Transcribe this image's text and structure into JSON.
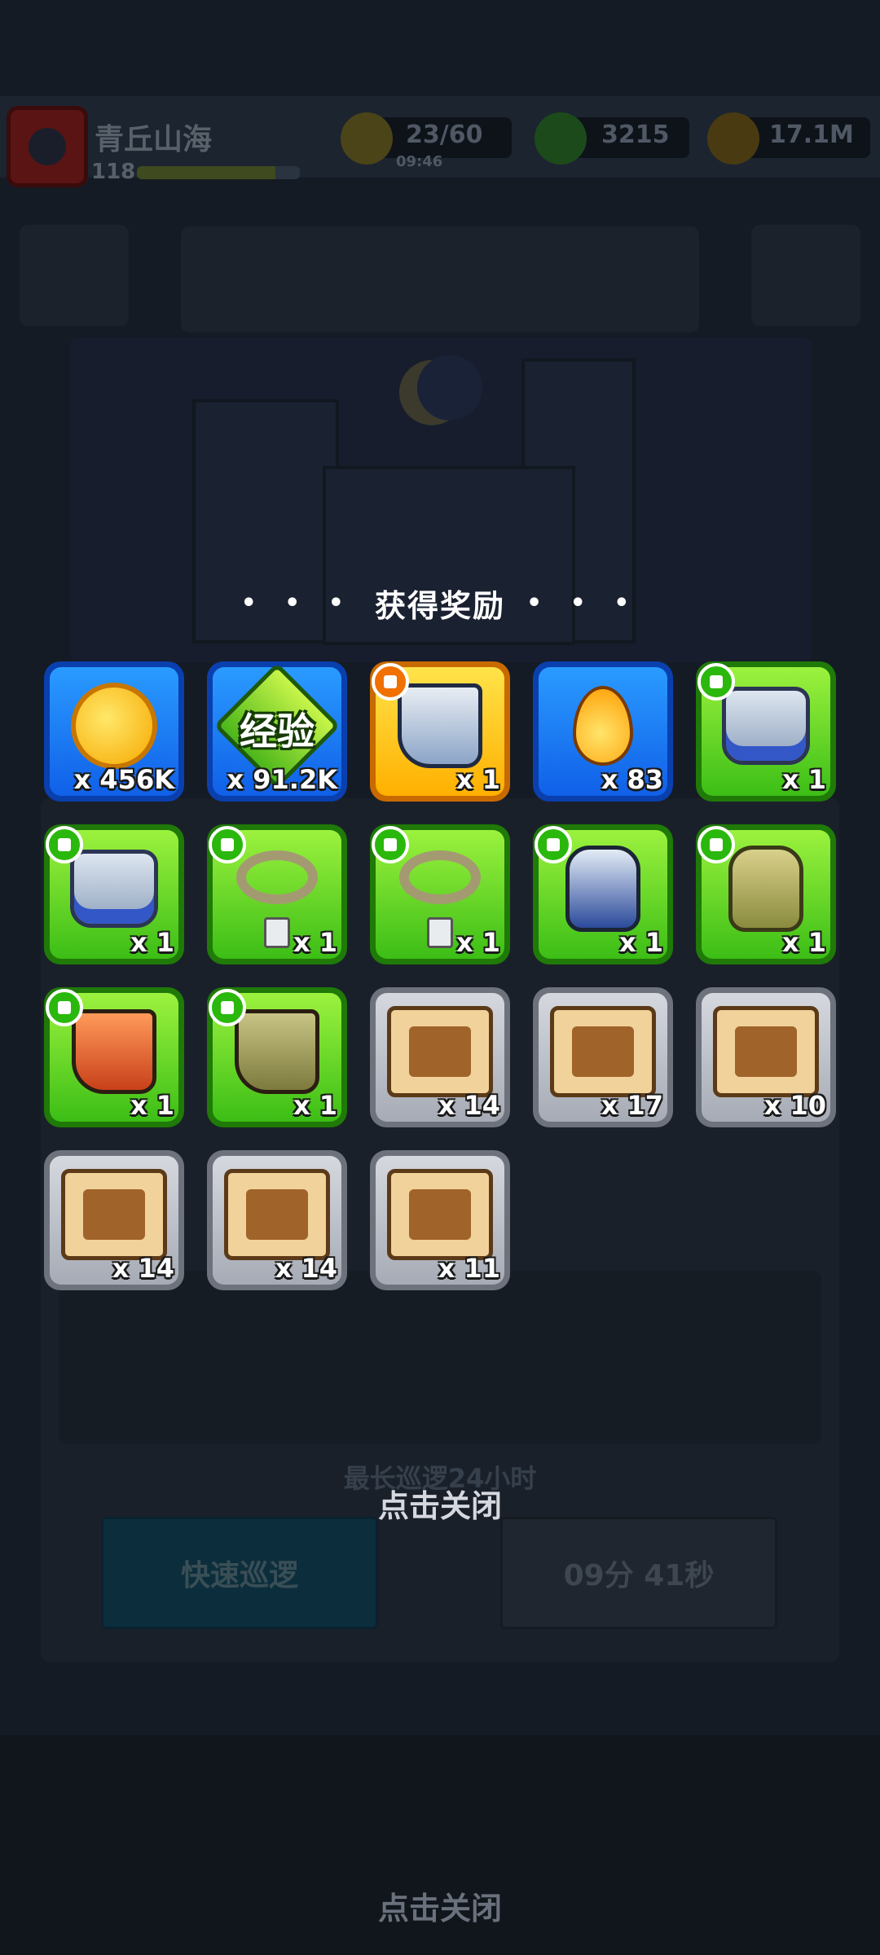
{
  "player": {
    "name": "青丘山海",
    "level": "118"
  },
  "resources": {
    "energy": {
      "value": "23/60",
      "timer": "09:46",
      "icon": "lightning-icon"
    },
    "gems": {
      "value": "3215",
      "icon": "green-gem-icon"
    },
    "gold": {
      "value": "17.1M",
      "icon": "gold-coin-icon"
    }
  },
  "patrol": {
    "max_duration_note": "最长巡逻24小时",
    "quick_patrol_label": "快速巡逻",
    "timer_label": "09分 41秒"
  },
  "reward_popup": {
    "title": "获得奖励",
    "dots_left": "• • •",
    "dots_right": "• • •",
    "close_hint": "点击关闭",
    "items": [
      {
        "name": "gold-coin",
        "icon": "gold-coin-icon",
        "rarity": "blue",
        "qty": "x 456K"
      },
      {
        "name": "experience",
        "icon": "exp-icon",
        "label": "经验",
        "rarity": "blue",
        "qty": "x 91.2K"
      },
      {
        "name": "boots-gold",
        "icon": "boot-icon",
        "rarity": "gold",
        "qty": "x 1",
        "badge": "boot-slot-icon"
      },
      {
        "name": "fuel-drop",
        "icon": "fuel-drop-icon",
        "rarity": "blue",
        "qty": "x 83"
      },
      {
        "name": "armor-green-1",
        "icon": "armor-icon",
        "rarity": "green",
        "qty": "x 1",
        "badge": "armor-slot-icon"
      },
      {
        "name": "armor-green-2",
        "icon": "armor-icon",
        "rarity": "green",
        "qty": "x 1",
        "badge": "armor-slot-icon"
      },
      {
        "name": "necklace-1",
        "icon": "necklace-icon",
        "rarity": "green",
        "qty": "x 1",
        "badge": "necklace-slot-icon"
      },
      {
        "name": "necklace-2",
        "icon": "necklace-icon",
        "rarity": "green",
        "qty": "x 1",
        "badge": "necklace-slot-icon"
      },
      {
        "name": "glove-blue",
        "icon": "glove-icon",
        "rarity": "green",
        "qty": "x 1",
        "badge": "glove-slot-icon"
      },
      {
        "name": "glove-tan",
        "icon": "glove-icon",
        "rarity": "green",
        "qty": "x 1",
        "badge": "glove-slot-icon"
      },
      {
        "name": "boots-red",
        "icon": "boot-icon",
        "rarity": "green",
        "qty": "x 1",
        "badge": "boot-slot-icon"
      },
      {
        "name": "boots-olive",
        "icon": "boot-icon",
        "rarity": "green",
        "qty": "x 1",
        "badge": "boot-slot-icon"
      },
      {
        "name": "scroll-weapon",
        "icon": "weapon-scroll-icon",
        "rarity": "grey",
        "qty": "x 14"
      },
      {
        "name": "scroll-armor",
        "icon": "armor-scroll-icon",
        "rarity": "grey",
        "qty": "x 17"
      },
      {
        "name": "scroll-necklace",
        "icon": "necklace-scroll-icon",
        "rarity": "grey",
        "qty": "x 10"
      },
      {
        "name": "scroll-belt",
        "icon": "belt-scroll-icon",
        "rarity": "grey",
        "qty": "x 14"
      },
      {
        "name": "scroll-glove",
        "icon": "glove-scroll-icon",
        "rarity": "grey",
        "qty": "x 14"
      },
      {
        "name": "scroll-boot",
        "icon": "boot-scroll-icon",
        "rarity": "grey",
        "qty": "x 11"
      }
    ]
  }
}
